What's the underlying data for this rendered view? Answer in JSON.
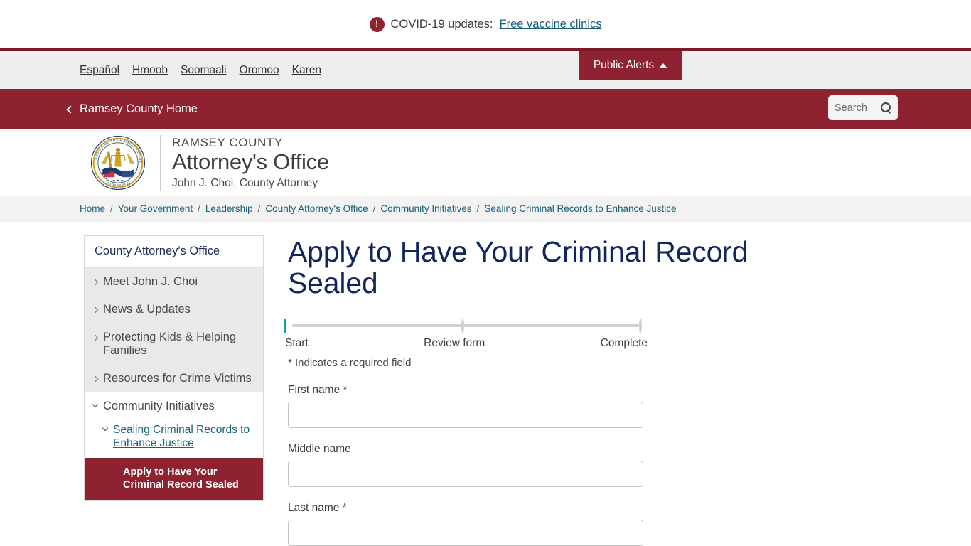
{
  "alert": {
    "icon": "alert-circle-icon",
    "text": "COVID-19 updates:",
    "link": "Free vaccine clinics"
  },
  "language_bar": {
    "links": [
      "Español",
      "Hmoob",
      "Soomaali",
      "Oromoo",
      "Karen"
    ],
    "public_alerts_label": "Public Alerts",
    "public_alerts_caret": "caret-up-icon"
  },
  "nav": {
    "home_label": "Ramsey County Home",
    "back_icon": "chevron-left-icon",
    "search_placeholder": "Search",
    "search_value": "",
    "search_icon": "search-icon"
  },
  "identity": {
    "seal_icon": "ramsey-county-attorney-seal",
    "seal_ring_text": "OFFICE OF THE RAMSEY COUNTY ATTORNEY",
    "seal_bottom_text": "Minnesota",
    "line1": "RAMSEY COUNTY",
    "line2": "Attorney's Office",
    "line3": "John J. Choi, County Attorney"
  },
  "breadcrumb": {
    "separator": "/",
    "items": [
      "Home",
      "Your Government",
      "Leadership",
      "County Attorney's Office",
      "Community Initiatives",
      "Sealing Criminal Records to Enhance Justice"
    ]
  },
  "sidebar": {
    "title": "County Attorney's Office",
    "items": [
      {
        "label": "Meet John J. Choi",
        "icon": "chevron-right-icon"
      },
      {
        "label": "News & Updates",
        "icon": "chevron-right-icon"
      },
      {
        "label": "Protecting Kids & Helping Families",
        "icon": "chevron-right-icon"
      },
      {
        "label": "Resources for Crime Victims",
        "icon": "chevron-right-icon"
      }
    ],
    "open_group": {
      "label": "Community Initiatives",
      "icon": "chevron-down-icon"
    },
    "open_sub": {
      "label": "Sealing Criminal Records to Enhance Justice",
      "icon": "chevron-down-icon"
    },
    "active_item": "Apply to Have Your Criminal Record Sealed"
  },
  "main": {
    "title": "Apply to Have Your Criminal Record Sealed",
    "stepper": {
      "steps": [
        "Start",
        "Review form",
        "Complete"
      ],
      "current_index": 0,
      "active_color": "#0f9bbd",
      "track_color": "#cfcfcf"
    },
    "required_note": "* Indicates a required field",
    "fields": [
      {
        "label": "First name",
        "required": "*",
        "value": "",
        "placeholder": ""
      },
      {
        "label": "Middle name",
        "required": "",
        "value": "",
        "placeholder": ""
      },
      {
        "label": "Last name",
        "required": "*",
        "value": "",
        "placeholder": ""
      }
    ]
  },
  "colors": {
    "brand_red": "#8e2231",
    "brand_red_dark": "#7b1a25",
    "link_blue": "#18607c",
    "heading_navy": "#12265c",
    "teal": "#0f9bbd"
  }
}
